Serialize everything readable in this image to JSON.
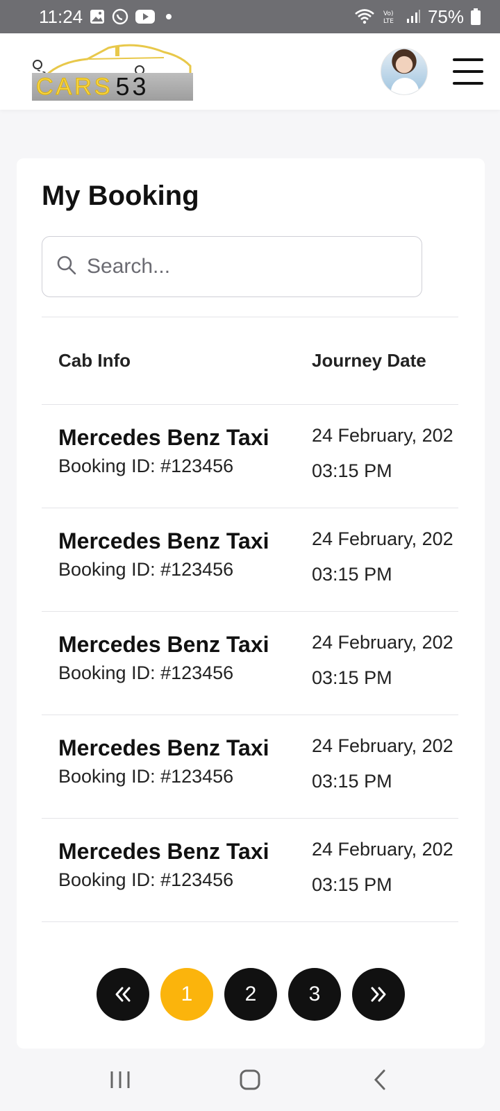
{
  "status_bar": {
    "time": "11:24",
    "battery": "75%",
    "icons": [
      "gallery-icon",
      "whatsapp-icon",
      "youtube-icon",
      "wifi-icon",
      "volte-icon",
      "signal-icon",
      "battery-icon"
    ]
  },
  "header": {
    "logo_text": "CARS",
    "logo_number": "53",
    "avatar": "support-agent-avatar",
    "menu_icon": "hamburger-icon"
  },
  "main": {
    "title": "My Booking",
    "search": {
      "placeholder": "Search...",
      "value": ""
    },
    "table": {
      "columns": [
        "Cab Info",
        "Journey Date"
      ],
      "rows": [
        {
          "cab": "Mercedes Benz Taxi",
          "booking_id": "Booking ID: #123456",
          "date": "24 February, 202",
          "time": "03:15 PM"
        },
        {
          "cab": "Mercedes Benz Taxi",
          "booking_id": "Booking ID: #123456",
          "date": "24 February, 202",
          "time": "03:15 PM"
        },
        {
          "cab": "Mercedes Benz Taxi",
          "booking_id": "Booking ID: #123456",
          "date": "24 February, 202",
          "time": "03:15 PM"
        },
        {
          "cab": "Mercedes Benz Taxi",
          "booking_id": "Booking ID: #123456",
          "date": "24 February, 202",
          "time": "03:15 PM"
        },
        {
          "cab": "Mercedes Benz Taxi",
          "booking_id": "Booking ID: #123456",
          "date": "24 February, 202",
          "time": "03:15 PM"
        }
      ]
    },
    "pagination": {
      "first": "«",
      "pages": [
        "1",
        "2",
        "3"
      ],
      "current": "1",
      "last": "»"
    }
  },
  "colors": {
    "accent": "#fbb40c",
    "dark": "#111111",
    "status_bar": "#6e6e72"
  }
}
